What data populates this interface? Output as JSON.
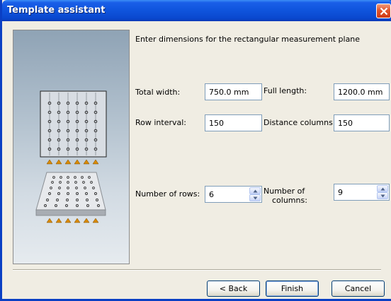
{
  "window": {
    "title": "Template assistant"
  },
  "prompt": "Enter dimensions for the rectangular measurement plane",
  "fields": {
    "total_width": {
      "label": "Total width:",
      "value": "750.0 mm"
    },
    "full_length": {
      "label": "Full length:",
      "value": "1200.0 mm"
    },
    "row_interval": {
      "label": "Row interval:",
      "value": "150"
    },
    "distance_columns": {
      "label": "Distance columns:",
      "value": "150"
    },
    "number_of_rows": {
      "label": "Number of rows:",
      "value": "6"
    },
    "number_of_columns": {
      "label_line1": "Number of",
      "label_line2": "columns:",
      "value": "9"
    }
  },
  "buttons": {
    "back": "< Back",
    "finish": "Finish",
    "cancel": "Cancel"
  },
  "colors": {
    "titlebar": "#0a48cf",
    "close": "#e0542b",
    "marker": "#d98a00"
  },
  "icons": [
    "close-icon",
    "spin-up-icon",
    "spin-down-icon",
    "grid-top-view-icon",
    "grid-perspective-icon"
  ]
}
